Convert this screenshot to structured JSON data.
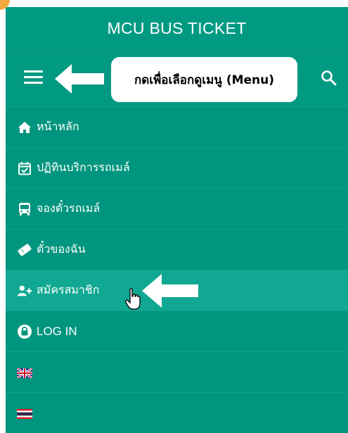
{
  "header": {
    "title": "MCU BUS TICKET"
  },
  "toolbar": {
    "menu_icon": "hamburger-icon",
    "tooltip_text": "กดเพื่อเลือกดูเมนู (Menu)",
    "search_icon": "search-icon"
  },
  "menu": {
    "items": [
      {
        "label": "หน้าหลัก",
        "icon": "home-icon"
      },
      {
        "label": "ปฏิทินบริการรถเมล์",
        "icon": "calendar-check-icon"
      },
      {
        "label": "จองตั๋วรถเมล์",
        "icon": "bus-icon"
      },
      {
        "label": "ตั๋วของฉัน",
        "icon": "ticket-icon"
      },
      {
        "label": "สมัครสมาชิก",
        "icon": "user-plus-icon"
      },
      {
        "label": "LOG IN",
        "icon": "lock-icon"
      },
      {
        "label": "",
        "icon": "uk-flag-icon"
      },
      {
        "label": "",
        "icon": "thai-flag-icon"
      }
    ]
  },
  "colors": {
    "app_background": "#00957e",
    "active_item": "#10a892",
    "text": "#ffffff",
    "corner_accent": "#f2a93b"
  }
}
